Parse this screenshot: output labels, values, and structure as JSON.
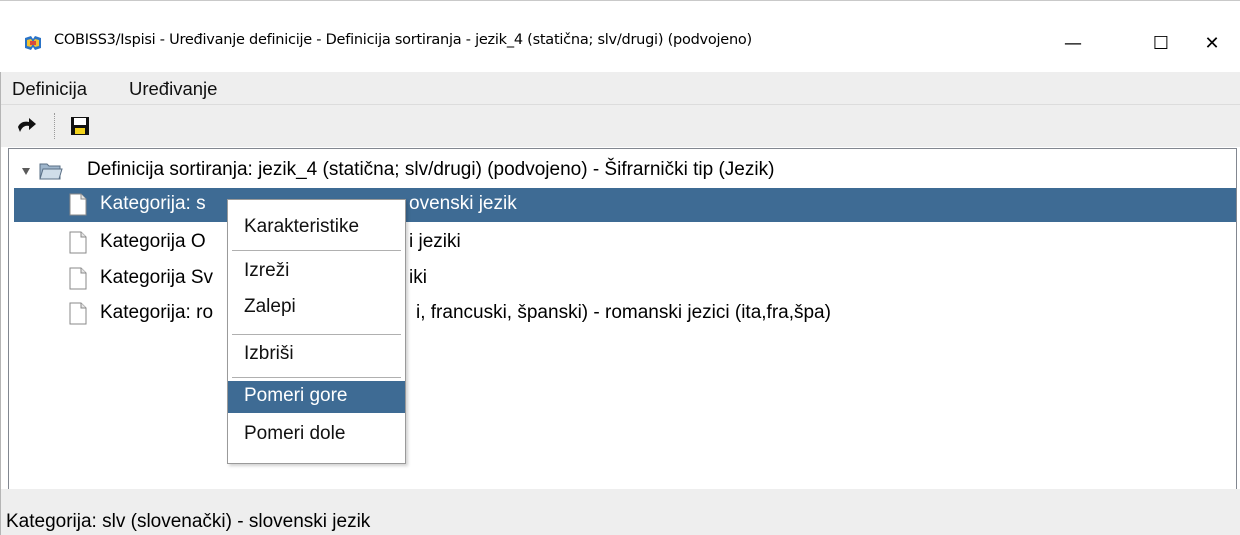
{
  "window": {
    "title": "COBISS3/Ispisi - Uređivanje definicije - Definicija sortiranja - jezik_4 (statična; slv/drugi) (podvojeno)",
    "minimize_glyph": "—",
    "maximize_glyph": "☐",
    "close_glyph": "✕",
    "app_icon": "cobiss-app-icon"
  },
  "menubar": {
    "items": [
      {
        "label": "Definicija"
      },
      {
        "label": "Uređivanje"
      }
    ]
  },
  "toolbar": {
    "buttons": [
      {
        "icon": "back-arrow-icon"
      },
      {
        "icon": "save-disk-icon"
      }
    ]
  },
  "tree": {
    "root": {
      "label": "Definicija sortiranja: jezik_4 (statična; slv/drugi) (podvojeno) - Šifrarnički tip (Jezik)",
      "expanded": true
    },
    "children": [
      {
        "label_left": "Kategorija: s",
        "label_right": "ovenski jezik",
        "selected": true
      },
      {
        "label_left": "Kategorija O",
        "label_right": "i jeziki",
        "selected": false
      },
      {
        "label_left": "Kategorija Sv",
        "label_right": "iki",
        "selected": false
      },
      {
        "label_left": "Kategorija: ro",
        "label_right": "i, francuski, španski) - romanski jezici (ita,fra,špa)",
        "selected": false
      }
    ]
  },
  "context_menu": {
    "items": [
      {
        "label": "Karakteristike"
      },
      {
        "label": "Izreži"
      },
      {
        "label": "Zalepi"
      },
      {
        "label": "Izbriši"
      },
      {
        "label": "Pomeri gore",
        "highlighted": true
      },
      {
        "label": "Pomeri dole"
      }
    ]
  },
  "status": {
    "text": "Kategorija: slv (slovenački) - slovenski jezik"
  },
  "colors": {
    "selection": "#3e6b94",
    "chrome": "#eeeeee",
    "border": "#828790"
  }
}
